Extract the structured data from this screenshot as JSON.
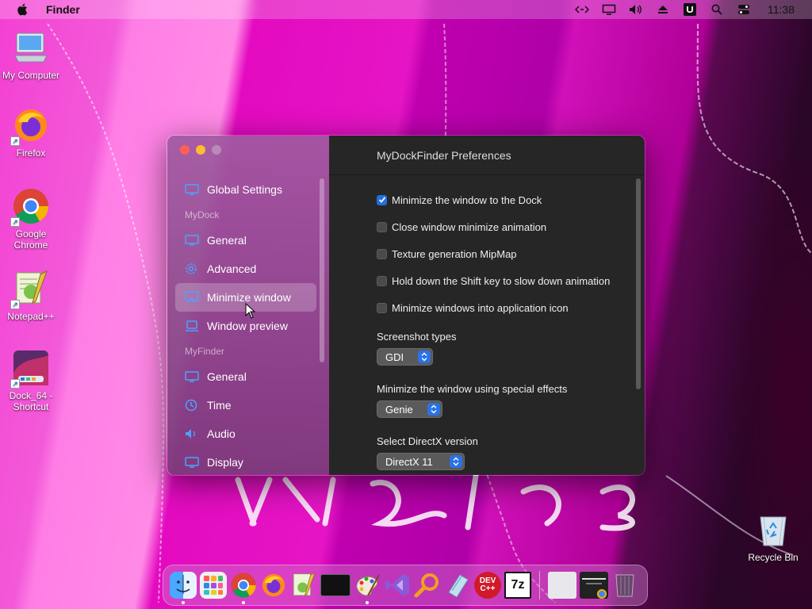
{
  "menubar": {
    "app_name": "Finder",
    "time": "11:38",
    "icons": [
      "apple-icon",
      "code-arrows-icon",
      "display-icon",
      "volume-icon",
      "eject-icon",
      "u-app-icon",
      "search-icon",
      "control-center-icon"
    ]
  },
  "desktop": {
    "icons": [
      {
        "label": "My Computer",
        "icon": "computer-icon"
      },
      {
        "label": "Firefox",
        "icon": "firefox-icon"
      },
      {
        "label": "Google Chrome",
        "icon": "chrome-icon"
      },
      {
        "label": "Notepad++",
        "icon": "notepadpp-icon"
      },
      {
        "label": "Dock_64 - Shortcut",
        "icon": "dock-shortcut-icon"
      },
      {
        "label": "Recycle Bin",
        "icon": "recycle-bin-icon"
      }
    ]
  },
  "window": {
    "title": "MyDockFinder Preferences",
    "sidebar": {
      "global": "Global Settings",
      "section_mydock": "MyDock",
      "mydock_items": [
        "General",
        "Advanced",
        "Minimize window",
        "Window preview"
      ],
      "section_myfinder": "MyFinder",
      "myfinder_items": [
        "General",
        "Time",
        "Audio",
        "Display"
      ],
      "active": "Minimize window"
    },
    "options": [
      {
        "label": "Minimize the window to the Dock",
        "checked": true
      },
      {
        "label": "Close window minimize animation",
        "checked": false
      },
      {
        "label": "Texture generation MipMap",
        "checked": false
      },
      {
        "label": "Hold down the Shift key to slow down animation",
        "checked": false
      },
      {
        "label": "Minimize windows into application icon",
        "checked": false
      }
    ],
    "screenshot_label": "Screenshot types",
    "screenshot_value": "GDI",
    "effects_label": "Minimize the window using special effects",
    "effects_value": "Genie",
    "directx_label": "Select DirectX version",
    "directx_value": "DirectX 11"
  },
  "dock": {
    "items": [
      "finder-icon",
      "launchpad-icon",
      "chrome-icon",
      "firefox-icon",
      "notepadpp-icon",
      "terminal-icon",
      "paint-icon",
      "visual-studio-icon",
      "search-magnifier-icon",
      "notes-icon",
      "devcpp-icon",
      "7zip-icon"
    ],
    "dev_label": "DEV C++",
    "zip_label": "7z"
  },
  "colors": {
    "accent": "#1f6fe0",
    "content_bg": "#262626"
  }
}
